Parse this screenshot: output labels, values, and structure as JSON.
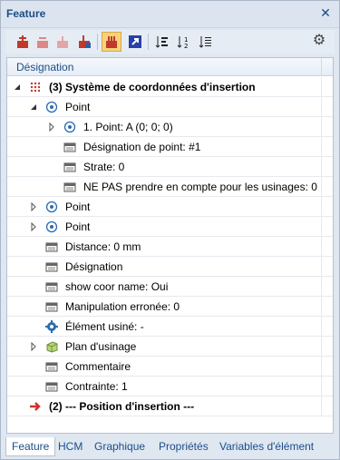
{
  "panel": {
    "title": "Feature",
    "close_glyph": "✕"
  },
  "toolbar": {
    "buttons": [
      "feature-add-icon",
      "feature-remove-icon",
      "feature-disabled-icon",
      "feature-export-icon",
      "feature-filter-icon",
      "feature-arrow-icon",
      "sort-tree-icon",
      "sort-number-icon",
      "sort-list-icon"
    ],
    "settings_icon": "gear-icon",
    "settings_glyph": "⚙"
  },
  "tree": {
    "header": "Désignation",
    "rows": [
      {
        "label": "(3) Système de coordonnées d'insertion",
        "bold": true
      },
      {
        "label": "Point"
      },
      {
        "label": "1. Point: A  (0; 0; 0)"
      },
      {
        "label": "Désignation de point: #1"
      },
      {
        "label": "Strate: 0"
      },
      {
        "label": "NE PAS prendre en compte pour les usinages: 0"
      },
      {
        "label": "Point"
      },
      {
        "label": "Point"
      },
      {
        "label": "Distance: 0 mm"
      },
      {
        "label": "Désignation"
      },
      {
        "label": "show coor name: Oui"
      },
      {
        "label": "Manipulation erronée: 0"
      },
      {
        "label": "Élément usiné: -"
      },
      {
        "label": "Plan d'usinage"
      },
      {
        "label": "Commentaire"
      },
      {
        "label": "Contrainte: 1"
      },
      {
        "label": "(2) --- Position  d'insertion ---",
        "bold": true
      }
    ]
  },
  "tabs": [
    "Feature",
    "HCM",
    "Graphique",
    "Propriétés",
    "Variables d'élément"
  ],
  "active_tab": "Feature"
}
